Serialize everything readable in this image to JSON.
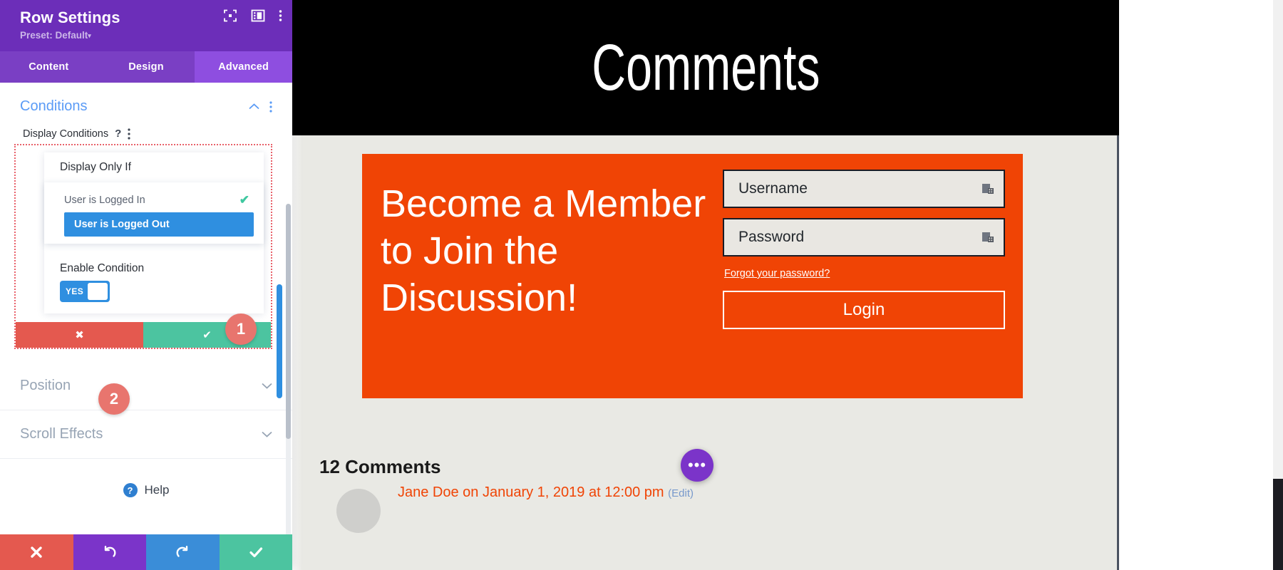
{
  "settings_panel": {
    "title": "Row Settings",
    "preset": "Preset: Default",
    "preset_caret": "▾",
    "header_icons": [
      {
        "name": "focus-frame-icon"
      },
      {
        "name": "layout-panel-icon"
      },
      {
        "name": "kebab-menu-icon"
      }
    ],
    "tabs": [
      {
        "label": "Content",
        "active": false
      },
      {
        "label": "Design",
        "active": false
      },
      {
        "label": "Advanced",
        "active": true
      }
    ],
    "sections": {
      "conditions": {
        "title": "Conditions",
        "field_label": "Display Conditions",
        "help_glyph": "?",
        "display_only_if_label": "Display Only If",
        "options": [
          {
            "label": "User is Logged In",
            "selected": false,
            "checked": true
          },
          {
            "label": "User is Logged Out",
            "selected": true,
            "checked": false
          }
        ],
        "check_glyph": "✔",
        "enable_label": "Enable Condition",
        "toggle_value": "YES",
        "cancel_glyph": "✖",
        "confirm_glyph": "✔",
        "badges": [
          {
            "number": "1"
          },
          {
            "number": "2"
          }
        ]
      },
      "position": {
        "title": "Position"
      },
      "scroll_effects": {
        "title": "Scroll Effects"
      }
    },
    "help": {
      "glyph": "?",
      "label": "Help"
    },
    "footer_buttons": [
      {
        "name": "discard-button",
        "icon": "close-icon",
        "color": "#e4594f"
      },
      {
        "name": "undo-button",
        "icon": "undo-icon",
        "color": "#7b34c9"
      },
      {
        "name": "redo-button",
        "icon": "redo-icon",
        "color": "#3a8dd8"
      },
      {
        "name": "save-button",
        "icon": "check-icon",
        "color": "#4cc4a0"
      }
    ],
    "colors": {
      "header_purple": "#6c2eb9",
      "tab_purple": "#7a3fc4",
      "tab_active_purple": "#8e4ee0",
      "link_blue": "#5a9bf6",
      "select_blue": "#2f8fe0",
      "green": "#4cc4a0",
      "red": "#e4594f",
      "badge_red": "#e8756e"
    }
  },
  "preview": {
    "hero_title": "Comments",
    "cta": {
      "heading": "Become a Member to Join the Discussion!",
      "username_placeholder": "Username",
      "password_placeholder": "Password",
      "forgot_link": "Forgot your password?",
      "login_button": "Login",
      "background_color": "#f04405"
    },
    "comments": {
      "count_label": "12 Comments",
      "first_comment_meta": "Jane Doe on January 1, 2019 at 12:00 pm",
      "edit_link": "(Edit)"
    },
    "fab": {
      "glyph": "•••",
      "color": "#7b34c9"
    }
  }
}
